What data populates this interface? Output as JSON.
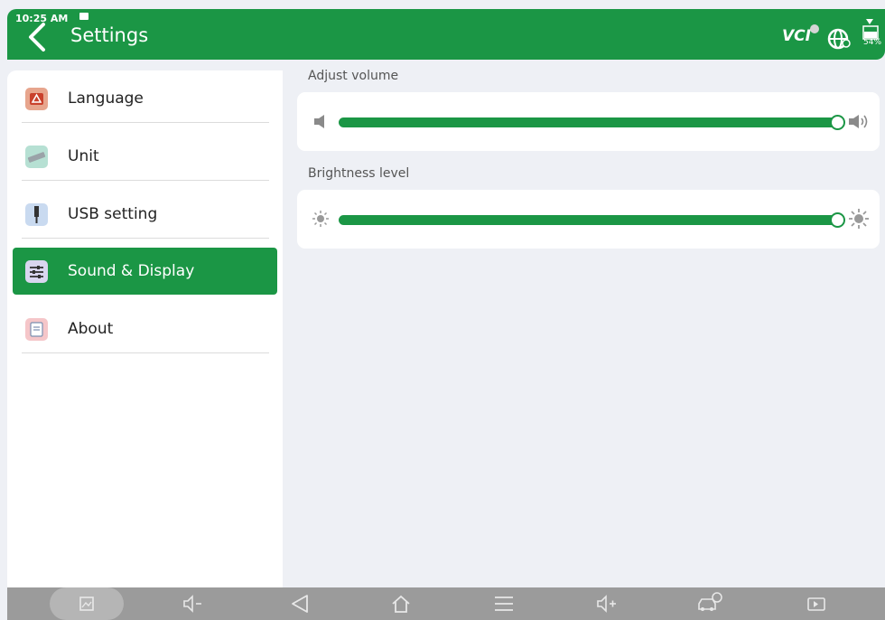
{
  "status": {
    "time": "10:25 AM",
    "battery": "54%"
  },
  "header": {
    "title": "Settings",
    "vci_label": "VCI"
  },
  "sidebar": {
    "items": [
      {
        "label": "Language",
        "icon": "language-icon",
        "active": false
      },
      {
        "label": "Unit",
        "icon": "ruler-icon",
        "active": false
      },
      {
        "label": "USB setting",
        "icon": "usb-icon",
        "active": false
      },
      {
        "label": "Sound & Display",
        "icon": "sliders-icon",
        "active": true
      },
      {
        "label": "About",
        "icon": "document-icon",
        "active": false
      }
    ]
  },
  "main": {
    "volume": {
      "label": "Adjust volume",
      "level_percent": 100
    },
    "brightness": {
      "label": "Brightness level",
      "level_percent": 100
    }
  },
  "navbar": {
    "buttons": [
      "screenshot-icon",
      "volume-down-icon",
      "back-icon",
      "home-icon",
      "menu-icon",
      "volume-up-icon",
      "car-diagnostics-icon",
      "screen-record-icon"
    ]
  },
  "colors": {
    "accent": "#1b9645",
    "background": "#eef0f5",
    "navbar": "#9b9b9b"
  }
}
